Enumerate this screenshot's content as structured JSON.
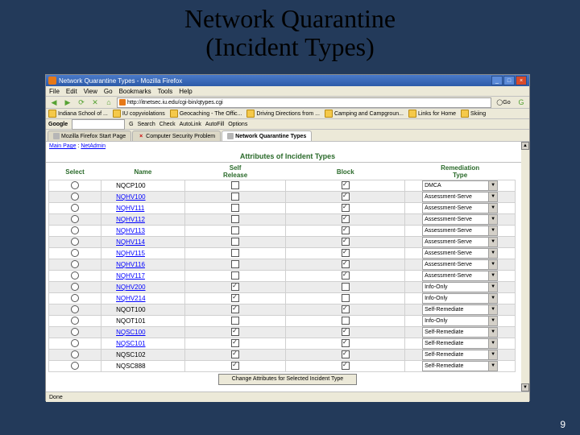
{
  "slide_title_line1": "Network Quarantine",
  "slide_title_line2": "(Incident Types)",
  "page_number": "9",
  "window_title": "Network Quarantine Types - Mozilla Firefox",
  "menubar": [
    "File",
    "Edit",
    "View",
    "Go",
    "Bookmarks",
    "Tools",
    "Help"
  ],
  "url_value": "http://itnetsec.iu.edu/cgi-bin/qtypes.cgi",
  "go_label": "Go",
  "bookmarks": [
    "Indiana School of ...",
    "IU copyviolations",
    "Geocaching - The Offic...",
    "Driving Directions from ...",
    "Camping and Campgroun...",
    "Links for Home",
    "Skiing"
  ],
  "google_label": "Google",
  "google_btns": [
    "G",
    "Search",
    "Check",
    "AutoLink",
    "AutoFill",
    "Options"
  ],
  "tabs": [
    "Mozilla Firefox Start Page",
    "Computer Security Problem",
    "Network Quarantine Types"
  ],
  "active_tab": 2,
  "crumbs": {
    "main": "Main Page",
    "netadmin": "NetAdmin",
    "sep": " : "
  },
  "page_heading": "Attributes of Incident Types",
  "headers": {
    "select": "Select",
    "name": "Name",
    "selfrel_line1": "Self",
    "selfrel_line2": "Release",
    "block": "Block",
    "remed_line1": "Remediation",
    "remed_line2": "Type"
  },
  "rows": [
    {
      "name": "NQCP100",
      "link": false,
      "self": false,
      "block": true,
      "remed": "DMCA"
    },
    {
      "name": "NQHV100",
      "link": true,
      "self": false,
      "block": true,
      "remed": "Assessment-Serve"
    },
    {
      "name": "NQHV111",
      "link": true,
      "self": false,
      "block": true,
      "remed": "Assessment-Serve"
    },
    {
      "name": "NQHV112",
      "link": true,
      "self": false,
      "block": true,
      "remed": "Assessment-Serve"
    },
    {
      "name": "NQHV113",
      "link": true,
      "self": false,
      "block": true,
      "remed": "Assessment-Serve"
    },
    {
      "name": "NQHV114",
      "link": true,
      "self": false,
      "block": true,
      "remed": "Assessment-Serve"
    },
    {
      "name": "NQHV115",
      "link": true,
      "self": false,
      "block": true,
      "remed": "Assessment-Serve"
    },
    {
      "name": "NQHV116",
      "link": true,
      "self": false,
      "block": true,
      "remed": "Assessment-Serve"
    },
    {
      "name": "NQHV117",
      "link": true,
      "self": false,
      "block": true,
      "remed": "Assessment-Serve"
    },
    {
      "name": "NQHV200",
      "link": true,
      "self": true,
      "block": false,
      "remed": "Info-Only"
    },
    {
      "name": "NQHV214",
      "link": true,
      "self": true,
      "block": false,
      "remed": "Info-Only"
    },
    {
      "name": "NQOT100",
      "link": false,
      "self": true,
      "block": true,
      "remed": "Self-Remediate"
    },
    {
      "name": "NQOT101",
      "link": false,
      "self": false,
      "block": false,
      "remed": "Info-Only"
    },
    {
      "name": "NQSC100",
      "link": true,
      "self": true,
      "block": true,
      "remed": "Self-Remediate"
    },
    {
      "name": "NQSC101",
      "link": true,
      "self": true,
      "block": true,
      "remed": "Self-Remediate"
    },
    {
      "name": "NQSC102",
      "link": false,
      "self": true,
      "block": true,
      "remed": "Self-Remediate"
    },
    {
      "name": "NQSC888",
      "link": false,
      "self": true,
      "block": true,
      "remed": "Self-Remediate"
    }
  ],
  "change_button": "Change Attributes for Selected Incident Type",
  "status_text": "Done",
  "chart_data": {
    "type": "table",
    "title": "Attributes of Incident Types",
    "columns": [
      "Name",
      "Self Release",
      "Block",
      "Remediation Type"
    ],
    "rows": [
      [
        "NQCP100",
        false,
        true,
        "DMCA"
      ],
      [
        "NQHV100",
        false,
        true,
        "Assessment-Serve"
      ],
      [
        "NQHV111",
        false,
        true,
        "Assessment-Serve"
      ],
      [
        "NQHV112",
        false,
        true,
        "Assessment-Serve"
      ],
      [
        "NQHV113",
        false,
        true,
        "Assessment-Serve"
      ],
      [
        "NQHV114",
        false,
        true,
        "Assessment-Serve"
      ],
      [
        "NQHV115",
        false,
        true,
        "Assessment-Serve"
      ],
      [
        "NQHV116",
        false,
        true,
        "Assessment-Serve"
      ],
      [
        "NQHV117",
        false,
        true,
        "Assessment-Serve"
      ],
      [
        "NQHV200",
        true,
        false,
        "Info-Only"
      ],
      [
        "NQHV214",
        true,
        false,
        "Info-Only"
      ],
      [
        "NQOT100",
        true,
        true,
        "Self-Remediate"
      ],
      [
        "NQOT101",
        false,
        false,
        "Info-Only"
      ],
      [
        "NQSC100",
        true,
        true,
        "Self-Remediate"
      ],
      [
        "NQSC101",
        true,
        true,
        "Self-Remediate"
      ],
      [
        "NQSC102",
        true,
        true,
        "Self-Remediate"
      ],
      [
        "NQSC888",
        true,
        true,
        "Self-Remediate"
      ]
    ]
  }
}
